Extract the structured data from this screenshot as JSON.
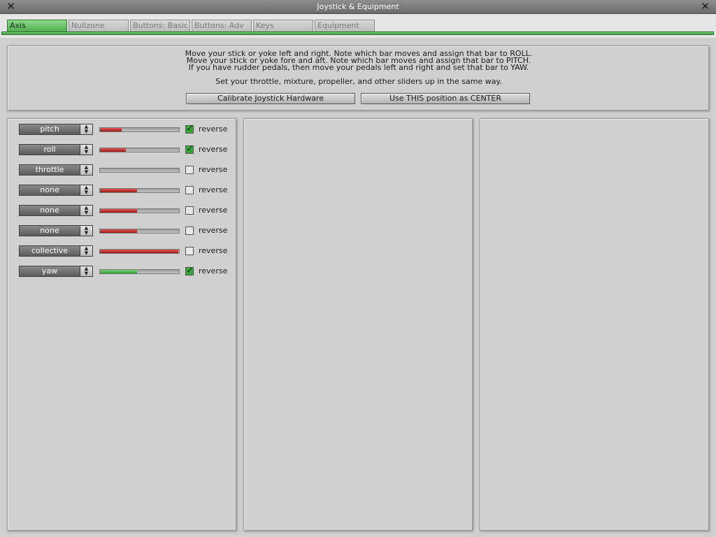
{
  "window": {
    "title": "Joystick & Equipment"
  },
  "tabs": [
    {
      "label": "Axis",
      "active": true
    },
    {
      "label": "Nullzone",
      "active": false
    },
    {
      "label": "Buttons: Basic",
      "active": false
    },
    {
      "label": "Buttons: Adv",
      "active": false
    },
    {
      "label": "Keys",
      "active": false
    },
    {
      "label": "Equipment",
      "active": false
    }
  ],
  "instructions": {
    "line1": "Move your stick or yoke left and right. Note which bar moves and assign that bar to ROLL.",
    "line2": "Move your stick or yoke fore and aft. Note which bar moves and assign that bar to PITCH.",
    "line3": "If you have rudder pedals, then move your pedals left and right and set that bar to YAW.",
    "line4": "Set your throttle, mixture, propeller, and other sliders up in the same way."
  },
  "buttons": {
    "calibrate": "Calibrate Joystick Hardware",
    "center": "Use THIS position as CENTER"
  },
  "reverse_label": "reverse",
  "colors": {
    "accent": "#4fae4f",
    "bar_red": "#c02828",
    "bar_green": "#3aa63a"
  },
  "axes": [
    {
      "assignment": "pitch",
      "level": 0.27,
      "bar_color": "red",
      "reverse": true
    },
    {
      "assignment": "roll",
      "level": 0.33,
      "bar_color": "red",
      "reverse": true
    },
    {
      "assignment": "throttle",
      "level": 0.0,
      "bar_color": "red",
      "reverse": false
    },
    {
      "assignment": "none",
      "level": 0.47,
      "bar_color": "red",
      "reverse": false
    },
    {
      "assignment": "none",
      "level": 0.47,
      "bar_color": "red",
      "reverse": false
    },
    {
      "assignment": "none",
      "level": 0.47,
      "bar_color": "red",
      "reverse": false
    },
    {
      "assignment": "collective",
      "level": 0.99,
      "bar_color": "red",
      "reverse": false
    },
    {
      "assignment": "yaw",
      "level": 0.47,
      "bar_color": "green",
      "reverse": true
    }
  ]
}
